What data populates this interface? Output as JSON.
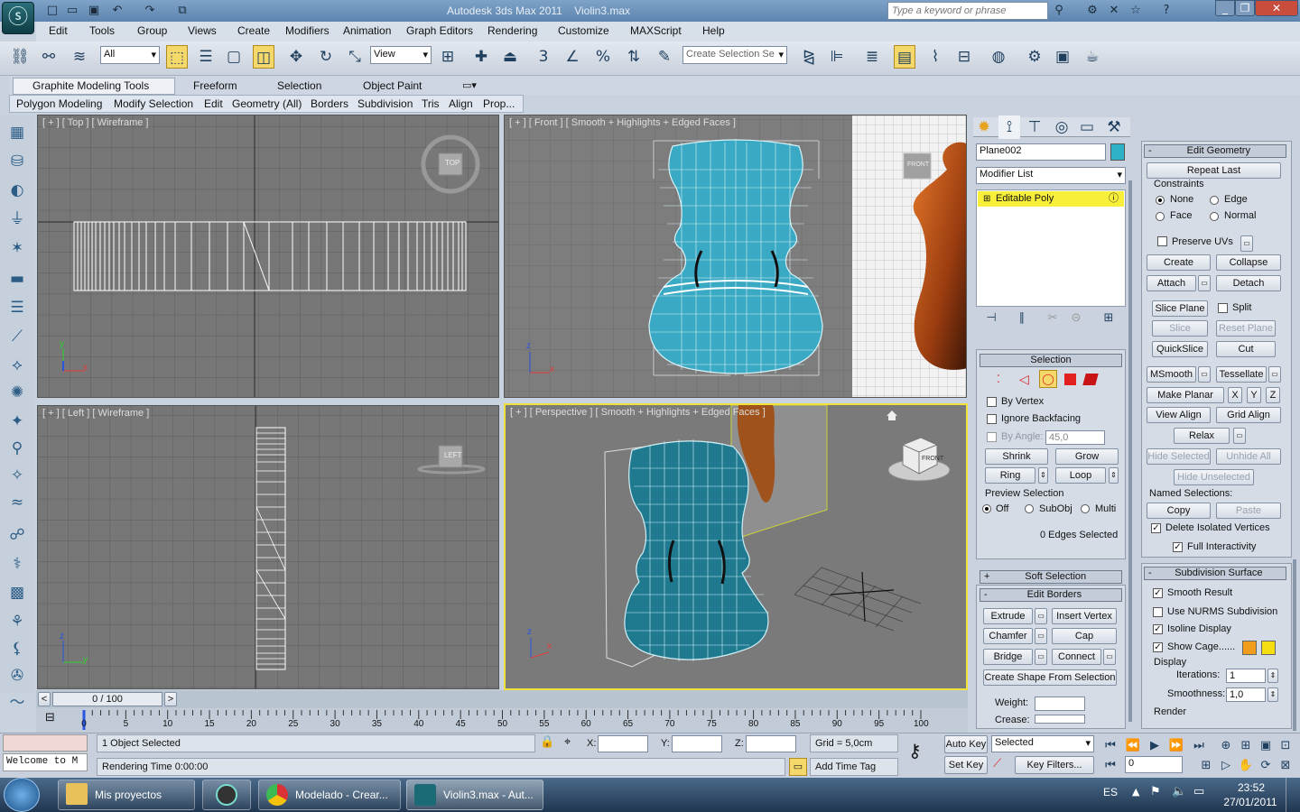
{
  "title": {
    "app": "Autodesk 3ds Max  2011",
    "file": "Violin3.max",
    "search_placeholder": "Type a keyword or phrase"
  },
  "menu": [
    "Edit",
    "Tools",
    "Group",
    "Views",
    "Create",
    "Modifiers",
    "Animation",
    "Graph Editors",
    "Rendering",
    "Customize",
    "MAXScript",
    "Help"
  ],
  "toolbar": {
    "filter": "All",
    "ref_coord": "View",
    "selection_set": "Create Selection Se",
    "snap_angle": "3"
  },
  "ribbon": {
    "tabs": [
      "Graphite Modeling Tools",
      "Freeform",
      "Selection",
      "Object Paint"
    ],
    "sub_tabs": [
      "Polygon Modeling",
      "Modify Selection",
      "Edit",
      "Geometry (All)",
      "Borders",
      "Subdivision",
      "Tris",
      "Align",
      "Prop..."
    ]
  },
  "viewports": {
    "top": {
      "label": "[ + ] [ Top ] [ Wireframe ]",
      "cube": "TOP"
    },
    "front": {
      "label": "[ + ] [ Front ] [ Smooth + Highlights + Edged Faces ]",
      "cube": "FRONT"
    },
    "left": {
      "label": "[ + ] [ Left ] [ Wireframe ]",
      "cube": "LEFT"
    },
    "persp": {
      "label": "[ + ] [ Perspective ] [ Smooth + Highlights + Edged Faces ]",
      "cube": "FRONT"
    },
    "axis_x": "x",
    "axis_y": "y",
    "axis_z": "z"
  },
  "command_panel": {
    "object_name": "Plane002",
    "modifier_list": "Modifier List",
    "stack_item": "Editable Poly",
    "selection": {
      "title": "Selection",
      "by_vertex": "By Vertex",
      "ignore_backfacing": "Ignore Backfacing",
      "by_angle": "By Angle:",
      "angle_value": "45,0",
      "shrink": "Shrink",
      "grow": "Grow",
      "ring": "Ring",
      "loop": "Loop",
      "preview_title": "Preview Selection",
      "off": "Off",
      "subobj": "SubObj",
      "multi": "Multi",
      "status": "0 Edges Selected"
    },
    "soft_selection": "Soft Selection",
    "edit_borders": {
      "title": "Edit Borders",
      "extrude": "Extrude",
      "insert_vertex": "Insert Vertex",
      "chamfer": "Chamfer",
      "cap": "Cap",
      "bridge": "Bridge",
      "connect": "Connect",
      "create_shape": "Create Shape From Selection",
      "weight": "Weight:",
      "crease": "Crease:"
    },
    "edit_geometry": {
      "title": "Edit Geometry",
      "repeat_last": "Repeat Last",
      "constraints": "Constraints",
      "none": "None",
      "edge": "Edge",
      "face": "Face",
      "normal": "Normal",
      "preserve_uvs": "Preserve UVs",
      "create": "Create",
      "collapse": "Collapse",
      "attach": "Attach",
      "detach": "Detach",
      "slice_plane": "Slice Plane",
      "split": "Split",
      "slice": "Slice",
      "reset_plane": "Reset Plane",
      "quickslice": "QuickSlice",
      "cut": "Cut",
      "msmooth": "MSmooth",
      "tessellate": "Tessellate",
      "make_planar": "Make Planar",
      "x": "X",
      "y": "Y",
      "z": "Z",
      "view_align": "View Align",
      "grid_align": "Grid Align",
      "relax": "Relax",
      "hide_selected": "Hide Selected",
      "unhide_all": "Unhide All",
      "hide_unselected": "Hide Unselected",
      "named_selections": "Named Selections:",
      "copy": "Copy",
      "paste": "Paste",
      "delete_isolated": "Delete Isolated Vertices",
      "full_interactivity": "Full Interactivity"
    },
    "subdivision_surface": {
      "title": "Subdivision Surface",
      "smooth_result": "Smooth Result",
      "use_nurms": "Use NURMS Subdivision",
      "isoline": "Isoline Display",
      "show_cage": "Show Cage......",
      "display": "Display",
      "iterations_label": "Iterations:",
      "iterations": "1",
      "smoothness_label": "Smoothness:",
      "smoothness": "1,0",
      "render": "Render"
    }
  },
  "timeline": {
    "frame": "0 / 100",
    "ticks": [
      "0",
      "5",
      "10",
      "15",
      "20",
      "25",
      "30",
      "35",
      "40",
      "45",
      "50",
      "55",
      "60",
      "65",
      "70",
      "75",
      "80",
      "85",
      "90",
      "95",
      "100"
    ]
  },
  "status": {
    "welcome": "Welcome to M",
    "selected": "1 Object Selected",
    "render_time": "Rendering Time  0:00:00",
    "x": "X:",
    "y": "Y:",
    "z": "Z:",
    "grid": "Grid = 5,0cm",
    "add_time_tag": "Add Time Tag",
    "auto_key": "Auto Key",
    "set_key": "Set Key",
    "key_mode": "Selected",
    "key_filters": "Key Filters...",
    "frame_value": "0"
  },
  "taskbar": {
    "items": [
      "Mis proyectos",
      "Modelado - Crear...",
      "Violin3.max - Aut..."
    ],
    "lang": "ES",
    "time": "23:52",
    "date": "27/01/2011"
  },
  "colors": {
    "mesh": "#3aa9c4",
    "active_border": "#f0e23a",
    "stack_highlight": "#f7ef3a"
  }
}
